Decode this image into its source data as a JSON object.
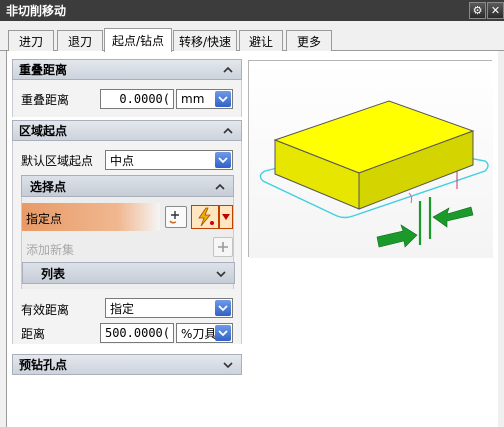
{
  "window": {
    "title": "非切削移动",
    "gear_icon": "gear-icon",
    "close_icon": "close-icon"
  },
  "tabs": [
    {
      "label": "进刀",
      "active": false
    },
    {
      "label": "退刀",
      "active": false
    },
    {
      "label": "起点/钻点",
      "active": true
    },
    {
      "label": "转移/快速",
      "active": false
    },
    {
      "label": "避让",
      "active": false
    },
    {
      "label": "更多",
      "active": false
    }
  ],
  "overlap": {
    "header": "重叠距离",
    "field_label": "重叠距离",
    "value": "0.0000(",
    "unit": "mm"
  },
  "region_start": {
    "header": "区域起点",
    "default_label": "默认区域起点",
    "default_value": "中点",
    "select_point": {
      "header": "选择点",
      "specify_label": "指定点",
      "add_set_label": "添加新集",
      "list_label": "列表"
    },
    "effective_label": "有效距离",
    "effective_value": "指定",
    "distance_label": "距离",
    "distance_value": "500.0000(",
    "distance_unit": "%刀具"
  },
  "predrill": {
    "header": "预钻孔点"
  },
  "colors": {
    "titlebar": "#3c3c3c",
    "block_yellow": "#ffff00",
    "arrow_green": "#1a9a2a",
    "path_cyan": "#40d0e0",
    "select_orange": "#e8a070"
  }
}
